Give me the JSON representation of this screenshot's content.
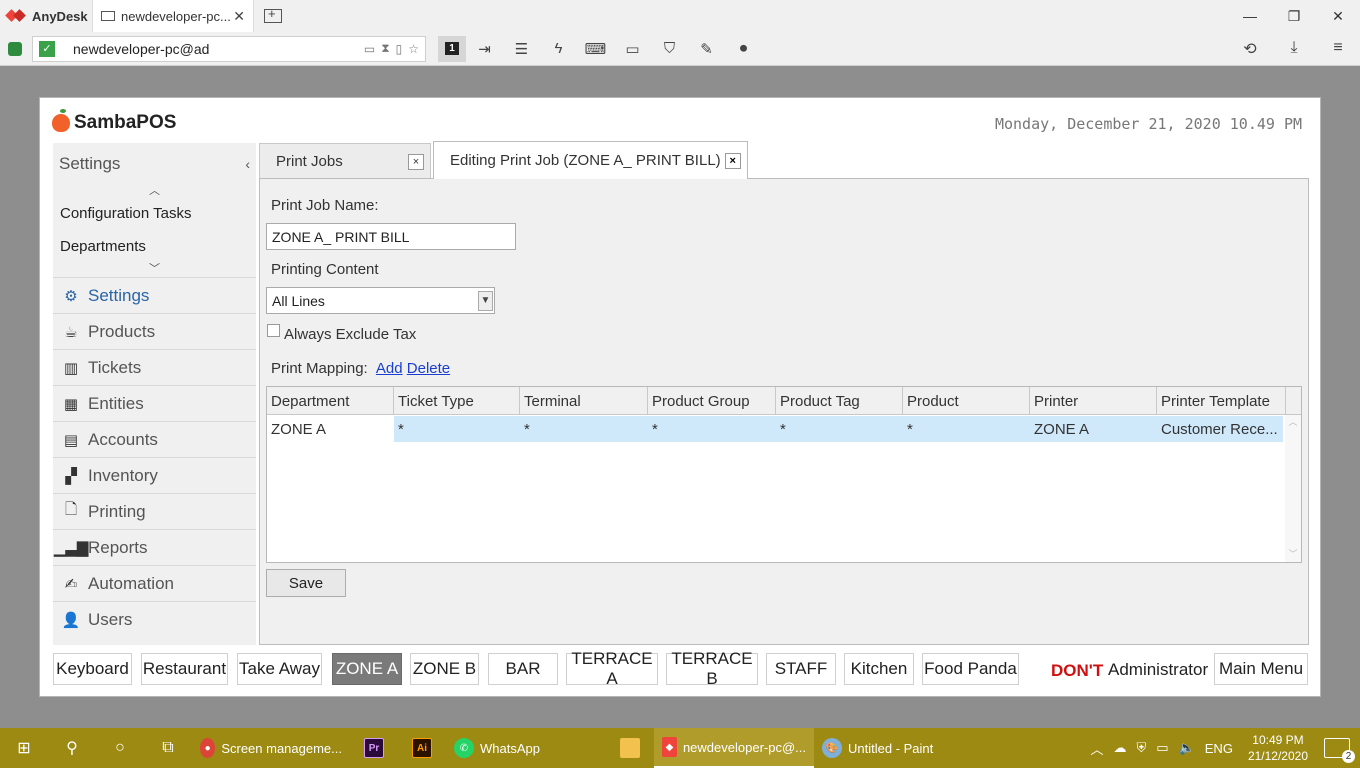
{
  "anydesk": {
    "app_name": "AnyDesk",
    "tab_title": "newdeveloper-pc...",
    "address": "newdeveloper-pc@ad",
    "monitor_number": "1"
  },
  "samba": {
    "brand": "SambaPOS",
    "datetime": "Monday, December 21, 2020 10.49 PM",
    "nav": {
      "header": "Settings",
      "sub_items": [
        "Configuration Tasks",
        "Departments"
      ],
      "items": [
        {
          "label": "Settings",
          "icon": "gear-icon"
        },
        {
          "label": "Products",
          "icon": "coffee-icon"
        },
        {
          "label": "Tickets",
          "icon": "tickets-icon"
        },
        {
          "label": "Entities",
          "icon": "entities-icon"
        },
        {
          "label": "Accounts",
          "icon": "calculator-icon"
        },
        {
          "label": "Inventory",
          "icon": "inventory-icon"
        },
        {
          "label": "Printing",
          "icon": "document-icon"
        },
        {
          "label": "Reports",
          "icon": "bar-chart-icon"
        },
        {
          "label": "Automation",
          "icon": "pen-icon"
        },
        {
          "label": "Users",
          "icon": "user-icon"
        }
      ]
    },
    "tabs": [
      {
        "label": "Print Jobs",
        "close": "×"
      },
      {
        "label": "Editing Print Job (ZONE A_ PRINT BILL)",
        "close": "×"
      }
    ],
    "form": {
      "name_label": "Print Job Name:",
      "name_value": "ZONE A_ PRINT BILL",
      "content_label": "Printing Content",
      "content_value": "All Lines",
      "exclude_tax_label": "Always Exclude Tax",
      "mapping_label": "Print Mapping:",
      "add_link": "Add",
      "delete_link": "Delete",
      "save_label": "Save"
    },
    "grid": {
      "columns": [
        "Department",
        "Ticket Type",
        "Terminal",
        "Product Group",
        "Product Tag",
        "Product",
        "Printer",
        "Printer Template"
      ],
      "rows": [
        [
          "ZONE A",
          "*",
          "*",
          "*",
          "*",
          "*",
          "ZONE A",
          "Customer Rece..."
        ]
      ]
    },
    "departments": [
      "Keyboard",
      "Restaurant",
      "Take Away",
      "ZONE A",
      "ZONE B",
      "BAR",
      "TERRACE A",
      "TERRACE B",
      "STAFF",
      "Kitchen",
      "Food Panda"
    ],
    "active_department": "ZONE A",
    "dont_label": "DON'T",
    "user_label": "Administrator",
    "main_menu_label": "Main Menu"
  },
  "taskbar": {
    "apps": [
      {
        "label": "Screen manageme...",
        "icon": "chrome-icon"
      },
      {
        "label": "",
        "icon": "premiere-icon",
        "text": "Pr"
      },
      {
        "label": "",
        "icon": "illustrator-icon",
        "text": "Ai"
      },
      {
        "label": "WhatsApp",
        "icon": "whatsapp-icon"
      },
      {
        "label": "",
        "icon": "file-explorer-icon"
      },
      {
        "label": "newdeveloper-pc@...",
        "icon": "anydesk-icon"
      },
      {
        "label": "Untitled - Paint",
        "icon": "paint-icon"
      }
    ],
    "lang": "ENG",
    "time": "10:49 PM",
    "date": "21/12/2020",
    "notifications": "2"
  }
}
